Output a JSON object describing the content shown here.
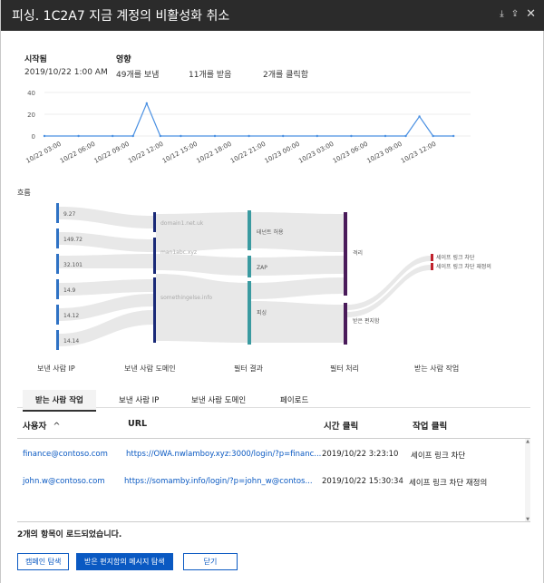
{
  "titlebar": {
    "title": "피싱. 1C2A7  지금 계정의 비활성화 취소",
    "icons": [
      "download-icon",
      "share-icon",
      "close-icon"
    ]
  },
  "summary": {
    "started_label": "시작됨",
    "started_value": "2019/10/22 1:00 AM",
    "impact_label": "영향",
    "sent": "49개를 보냄",
    "received": "11개를 받음",
    "clicked": "2개를 클릭함"
  },
  "chart_data": {
    "type": "line",
    "x": [
      "10/22 03:00",
      "10/22 06:00",
      "10/22 09:00",
      "10/22 12:00",
      "10/12 15:00",
      "10/22 18:00",
      "10/22 21:00",
      "10/23 00:00",
      "10/23 03:00",
      "10/23 06:00",
      "10/23 09:00",
      "10/23 12:00"
    ],
    "x_tick_labels": [
      "10/22 03:00",
      "10/22 06:00",
      "10/22 09:00",
      "10/22 12:00",
      "10/12 15:00",
      "10/22 18:00",
      "10/22 21:00",
      "10/23 00:00",
      "10/23 03:00",
      "10/23 06:00",
      "10/23 09:00",
      "10/23 12:00"
    ],
    "points": [
      {
        "x": 0.0,
        "y": 0
      },
      {
        "x": 1.0,
        "y": 0
      },
      {
        "x": 2.0,
        "y": 0
      },
      {
        "x": 2.6,
        "y": 0
      },
      {
        "x": 3.0,
        "y": 30
      },
      {
        "x": 3.4,
        "y": 0
      },
      {
        "x": 4.0,
        "y": 0
      },
      {
        "x": 5.0,
        "y": 0
      },
      {
        "x": 6.0,
        "y": 0
      },
      {
        "x": 7.0,
        "y": 0
      },
      {
        "x": 8.0,
        "y": 0
      },
      {
        "x": 9.0,
        "y": 0
      },
      {
        "x": 10.0,
        "y": 0
      },
      {
        "x": 10.6,
        "y": 0
      },
      {
        "x": 11.0,
        "y": 18
      },
      {
        "x": 11.4,
        "y": 0
      },
      {
        "x": 12.0,
        "y": 0
      }
    ],
    "y_ticks": [
      0,
      20,
      40
    ],
    "ylim": [
      0,
      40
    ],
    "xlim": [
      0,
      12.5
    ],
    "color": "#4a90e2",
    "grid": true
  },
  "flow": {
    "label": "흐름",
    "sender_ips": [
      "9.27",
      "149.72",
      "32.101",
      "14.9",
      "14.12",
      "14.14"
    ],
    "sender_domains": [
      "domain1.net.uk",
      "man1abc.xyz",
      "somethingelse.info"
    ],
    "filter_results": [
      "테넌트 허용",
      "ZAP",
      "피싱"
    ],
    "filter_actions": [
      "격리",
      "받은 편지함"
    ],
    "recipient_actions": [
      "세이프 링크 차단",
      "세이프 링크 차단 재정의"
    ],
    "column_labels": [
      "보낸 사람 IP",
      "보낸 사람 도메인",
      "필터 결과",
      "필터 처리",
      "받는 사람 작업"
    ]
  },
  "tabs": [
    "받는 사람 작업",
    "보낸 사람 IP",
    "보낸 사람 도메인",
    "페이로드"
  ],
  "table": {
    "headers": [
      "사용자",
      "URL",
      "시간 클릭",
      "작업 클릭"
    ],
    "sort_indicator": "^",
    "rows": [
      {
        "user": "finance@contoso.com",
        "url": "https://OWA.nwlamboy.xyz:3000/login/?p=financ...",
        "time": "2019/10/22 3:23:10",
        "action": "세이프 링크 차단"
      },
      {
        "user": "john.w@contoso.com",
        "url": "https://somamby.info/login/?p=john_w@contos...",
        "time": "2019/10/22 15:30:34",
        "action": "세이프 링크 차단 재정의"
      }
    ]
  },
  "status_text": "2개의 항목이 로드되었습니다.",
  "buttons": {
    "campaign": "캠페인 탐색",
    "inbox": "받은 편지함의 메시지 탐색",
    "close": "닫기"
  },
  "colors": {
    "titlebar": "#2b2b2b",
    "ip_node": "#2f72c4",
    "domain_node": "#1a2a78",
    "filter_node": "#3a9aa0",
    "action_node": "#4a1b5a",
    "recipient_node": "#c0222c",
    "link": "#0a59c2"
  }
}
